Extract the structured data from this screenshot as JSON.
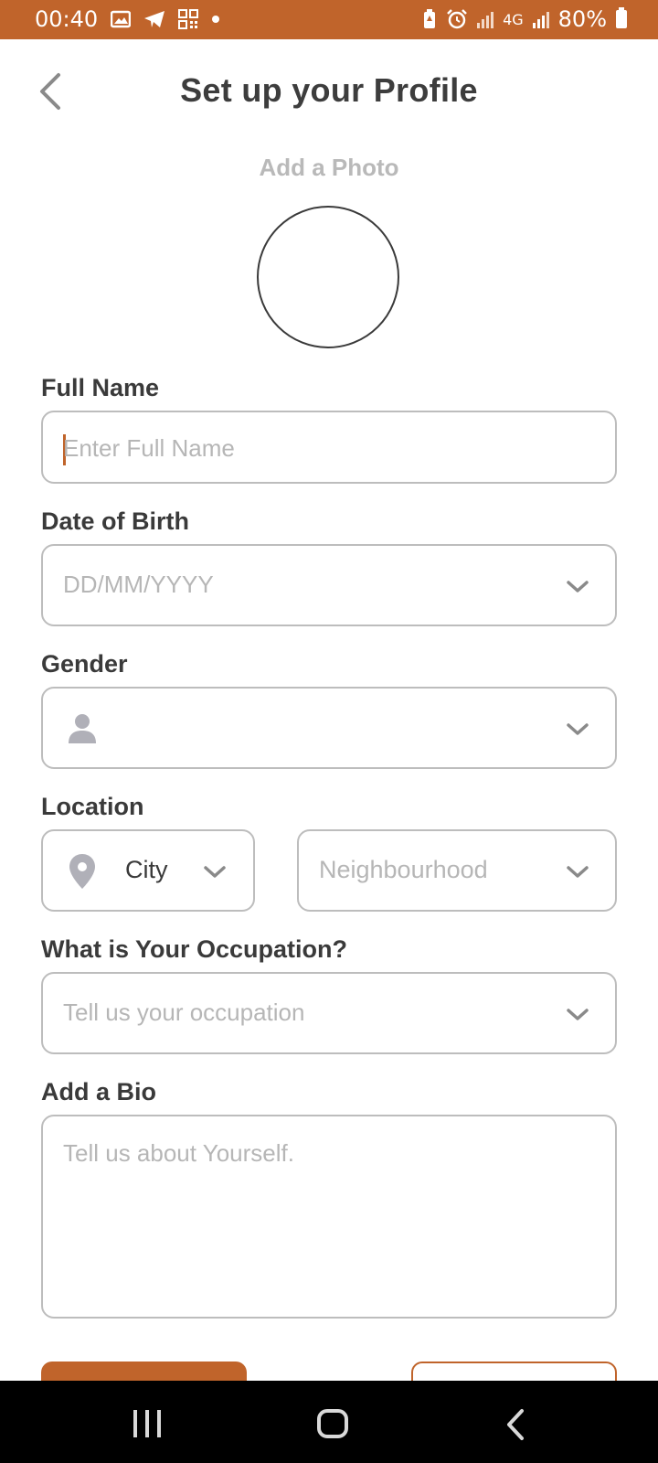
{
  "status_bar": {
    "time": "00:40",
    "network": "4G",
    "battery": "80%",
    "left_icons": [
      "gallery-icon",
      "telegram-icon",
      "qr-code-icon",
      "dot-icon"
    ],
    "right_icons": [
      "battery-saver-icon",
      "alarm-icon",
      "signal-icon",
      "network-4g-icon",
      "signal-icon",
      "battery-icon"
    ]
  },
  "header": {
    "title": "Set up your Profile",
    "back_icon": "chevron-left-icon"
  },
  "photo": {
    "label": "Add a Photo"
  },
  "form": {
    "full_name": {
      "label": "Full Name",
      "placeholder": "Enter Full Name",
      "value": ""
    },
    "dob": {
      "label": "Date of Birth",
      "placeholder": "DD/MM/YYYY"
    },
    "gender": {
      "label": "Gender",
      "icon": "person-icon",
      "value": ""
    },
    "location": {
      "label": "Location",
      "city": "City",
      "city_icon": "location-pin-icon",
      "neighbourhood_placeholder": "Neighbourhood"
    },
    "occupation": {
      "label": "What is Your Occupation?",
      "placeholder": "Tell us your occupation"
    },
    "bio": {
      "label": "Add a Bio",
      "placeholder": "Tell us about Yourself."
    }
  },
  "colors": {
    "accent": "#c0642b",
    "text": "#3a3a3a",
    "placeholder": "#b6b6b6",
    "border": "#bdbdbd"
  },
  "nav_bar": {
    "icons": [
      "recent-apps-icon",
      "home-icon",
      "back-icon"
    ]
  }
}
